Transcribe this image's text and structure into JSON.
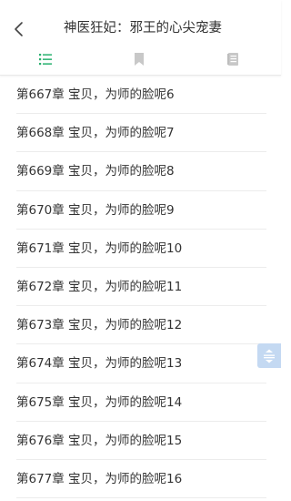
{
  "header": {
    "title": "神医狂妃：邪王的心尖宠妻",
    "back_icon": "chevron-left-icon"
  },
  "tabs": [
    {
      "name": "catalog",
      "icon": "list-icon",
      "active": true,
      "color": "#27b06e"
    },
    {
      "name": "bookmark",
      "icon": "bookmark-icon",
      "active": false,
      "color": "#c8c8c8"
    },
    {
      "name": "notes",
      "icon": "document-icon",
      "active": false,
      "color": "#c8c8c8"
    }
  ],
  "chapters": [
    "第667章 宝贝，为师的脸呢6",
    "第668章 宝贝，为师的脸呢7",
    "第669章 宝贝，为师的脸呢8",
    "第670章 宝贝，为师的脸呢9",
    "第671章 宝贝，为师的脸呢10",
    "第672章 宝贝，为师的脸呢11",
    "第673章 宝贝，为师的脸呢12",
    "第674章 宝贝，为师的脸呢13",
    "第675章 宝贝，为师的脸呢14",
    "第676章 宝贝，为师的脸呢15",
    "第677章 宝贝，为师的脸呢16"
  ],
  "scroll_handle": {
    "icon": "scroll-handle-icon",
    "color": "#c4d9f2"
  }
}
